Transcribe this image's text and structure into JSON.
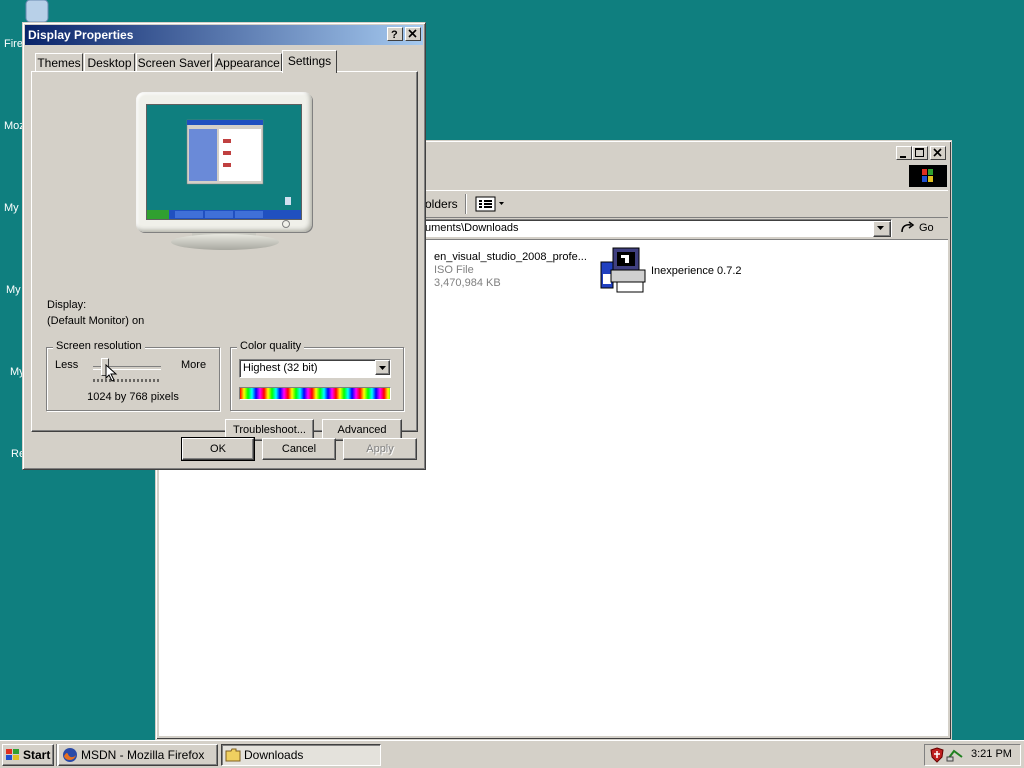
{
  "desktop": {
    "icons": [
      {
        "label": "Firef"
      },
      {
        "label": "Mozi"
      },
      {
        "label": "My I"
      },
      {
        "label": "My"
      },
      {
        "label": "My"
      },
      {
        "label": "Re"
      }
    ]
  },
  "explorer": {
    "toolbar": {
      "folders_label": "olders"
    },
    "address": {
      "value": "uments\\Downloads",
      "go_label": "Go"
    },
    "files": [
      {
        "name": "en_visual_studio_2008_profe...",
        "type": "ISO File",
        "size": "3,470,984 KB"
      },
      {
        "name": "Inexperience 0.7.2"
      }
    ]
  },
  "dialog": {
    "title": "Display Properties",
    "tabs": [
      "Themes",
      "Desktop",
      "Screen Saver",
      "Appearance",
      "Settings"
    ],
    "active_tab": "Settings",
    "display_label": "Display:",
    "display_value": "(Default Monitor) on",
    "resolution": {
      "title": "Screen resolution",
      "less": "Less",
      "more": "More",
      "value_text": "1024 by 768 pixels"
    },
    "color_quality": {
      "title": "Color quality",
      "selected": "Highest (32 bit)"
    },
    "buttons": {
      "troubleshoot": "Troubleshoot...",
      "advanced": "Advanced",
      "ok": "OK",
      "cancel": "Cancel",
      "apply": "Apply"
    }
  },
  "taskbar": {
    "start_label": "Start",
    "tasks": [
      {
        "label": "MSDN - Mozilla Firefox"
      },
      {
        "label": "Downloads"
      }
    ],
    "clock": "3:21 PM"
  },
  "colors": {
    "desktop": "#0f7f7f",
    "title_active_start": "#0a246a",
    "title_active_end": "#a6caf0",
    "face": "#d4d0c8"
  }
}
